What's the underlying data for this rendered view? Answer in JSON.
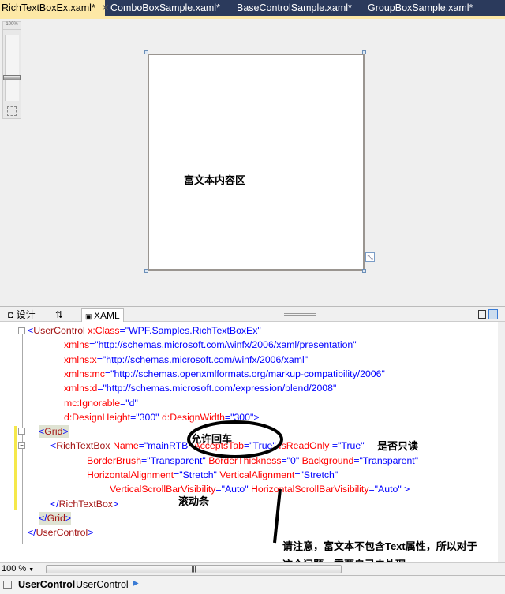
{
  "tabs": [
    {
      "label": "RichTextBoxEx.xaml*",
      "active": true
    },
    {
      "label": "ComboBoxSample.xaml*"
    },
    {
      "label": "BaseControlSample.xaml*"
    },
    {
      "label": "GroupBoxSample.xaml*"
    }
  ],
  "tab_close": "✕",
  "zoom_slider": {
    "label": "100%",
    "value_percent": 100
  },
  "designer": {
    "content_label": "富文本内容区"
  },
  "split_tabs": {
    "design": "设计",
    "swap": "⇅",
    "xaml": "XAML"
  },
  "code_lines": [
    [
      {
        "t": "<",
        "c": "punct"
      },
      {
        "t": "UserControl",
        "c": "tag"
      },
      {
        "t": " x:Class",
        "c": "attr"
      },
      {
        "t": "=\"WPF.Samples.RichTextBoxEx\"",
        "c": "val"
      }
    ],
    [
      {
        "t": "xmlns",
        "c": "attr"
      },
      {
        "t": "=\"http://schemas.microsoft.com/winfx/2006/xaml/presentation\"",
        "c": "val"
      }
    ],
    [
      {
        "t": "xmlns:x",
        "c": "attr"
      },
      {
        "t": "=\"http://schemas.microsoft.com/winfx/2006/xaml\"",
        "c": "val"
      }
    ],
    [
      {
        "t": "xmlns:mc",
        "c": "attr"
      },
      {
        "t": "=\"http://schemas.openxmlformats.org/markup-compatibility/2006\"",
        "c": "val"
      }
    ],
    [
      {
        "t": "xmlns:d",
        "c": "attr"
      },
      {
        "t": "=\"http://schemas.microsoft.com/expression/blend/2008\"",
        "c": "val"
      }
    ],
    [
      {
        "t": "mc:Ignorable",
        "c": "attr"
      },
      {
        "t": "=\"d\"",
        "c": "val"
      }
    ],
    [
      {
        "t": "d:DesignHeight",
        "c": "attr"
      },
      {
        "t": "=\"300\"",
        "c": "val"
      },
      {
        "t": " d:DesignWidth",
        "c": "attr"
      },
      {
        "t": "=\"300\">",
        "c": "val"
      }
    ],
    [
      {
        "t": "<",
        "c": "punct"
      },
      {
        "t": "Grid",
        "c": "tag"
      },
      {
        "t": ">",
        "c": "punct"
      }
    ],
    [
      {
        "t": "<",
        "c": "punct"
      },
      {
        "t": "RichTextBox",
        "c": "tag"
      },
      {
        "t": " Name",
        "c": "attr"
      },
      {
        "t": "=\"mainRTB\"",
        "c": "val"
      },
      {
        "t": " AcceptsTab",
        "c": "attr"
      },
      {
        "t": "=\"True\"",
        "c": "val"
      },
      {
        "t": " IsReadOnly ",
        "c": "attr"
      },
      {
        "t": "=\"True\"",
        "c": "val"
      }
    ],
    [
      {
        "t": "BorderBrush",
        "c": "attr"
      },
      {
        "t": "=\"Transparent\"",
        "c": "val"
      },
      {
        "t": " BorderThickness",
        "c": "attr"
      },
      {
        "t": "=\"0\"",
        "c": "val"
      },
      {
        "t": " Background",
        "c": "attr"
      },
      {
        "t": "=\"Transparent\"",
        "c": "val"
      }
    ],
    [
      {
        "t": "HorizontalAlignment",
        "c": "attr"
      },
      {
        "t": "=\"Stretch\"",
        "c": "val"
      },
      {
        "t": " VerticalAlignment",
        "c": "attr"
      },
      {
        "t": "=\"Stretch\"",
        "c": "val"
      }
    ],
    [
      {
        "t": "VerticalScrollBarVisibility",
        "c": "attr"
      },
      {
        "t": "=\"Auto\"",
        "c": "val"
      },
      {
        "t": " HorizontalScrollBarVisibility",
        "c": "attr"
      },
      {
        "t": "=\"Auto\" >",
        "c": "val"
      }
    ],
    [
      {
        "t": "</",
        "c": "punct"
      },
      {
        "t": "RichTextBox",
        "c": "tag"
      },
      {
        "t": ">",
        "c": "punct"
      }
    ],
    [
      {
        "t": "</",
        "c": "punct"
      },
      {
        "t": "Grid",
        "c": "tag"
      },
      {
        "t": ">",
        "c": "punct"
      }
    ],
    [
      {
        "t": "</",
        "c": "punct"
      },
      {
        "t": "UserControl",
        "c": "tag"
      },
      {
        "t": ">",
        "c": "punct"
      }
    ]
  ],
  "annotations": {
    "accepts_enter": "允许回车",
    "readonly": "是否只读",
    "scrollbar": "滚动条",
    "note_line1": "请注意，富文本不包含Text属性，所以对于",
    "note_line2": "这个问题，需要自己去处理。"
  },
  "editor_zoom": "100 %",
  "status": {
    "bold": "UserControl",
    "crumb": "UserControl"
  }
}
